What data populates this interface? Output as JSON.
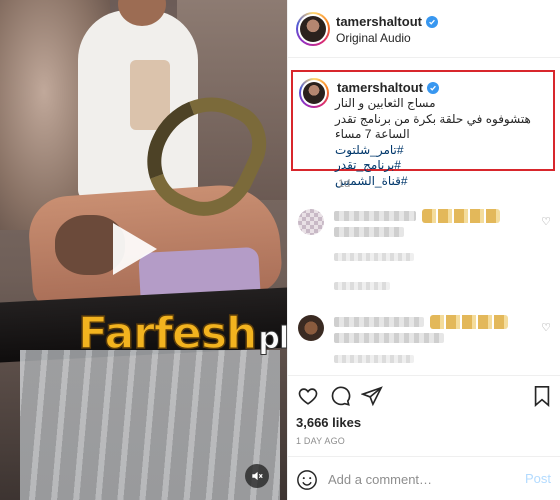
{
  "watermark": {
    "main": "Farfesh",
    "plus": "plus.com"
  },
  "header": {
    "username": "tamershaltout",
    "subtitle": "Original Audio"
  },
  "caption": {
    "username": "tamershaltout",
    "lines": [
      "مساج الثعابين و النار",
      "هتشوفوه في حلقة بكرة من برنامج تقدر",
      "الساعة 7 مساء"
    ],
    "hashtags": [
      "#تامر_شلتوت",
      "#برنامج_تقدر",
      "#قناة_الشمس"
    ],
    "time": "1d"
  },
  "likes": "3,666 likes",
  "date": "1 DAY AGO",
  "comment_bar": {
    "placeholder": "Add a comment…",
    "post_label": "Post"
  },
  "icons": {
    "verified": "verified-badge-icon",
    "play": "play-icon",
    "mute": "muted-speaker-icon",
    "like": "heart-icon",
    "comment": "speech-bubble-icon",
    "share": "paper-plane-icon",
    "save": "bookmark-icon",
    "emoji": "smiley-icon"
  },
  "colors": {
    "highlight_border": "#d8262c",
    "hashtag": "#00376b",
    "verified": "#3897f0",
    "post_button": "#b3dbff",
    "watermark": "#f2b31f"
  }
}
